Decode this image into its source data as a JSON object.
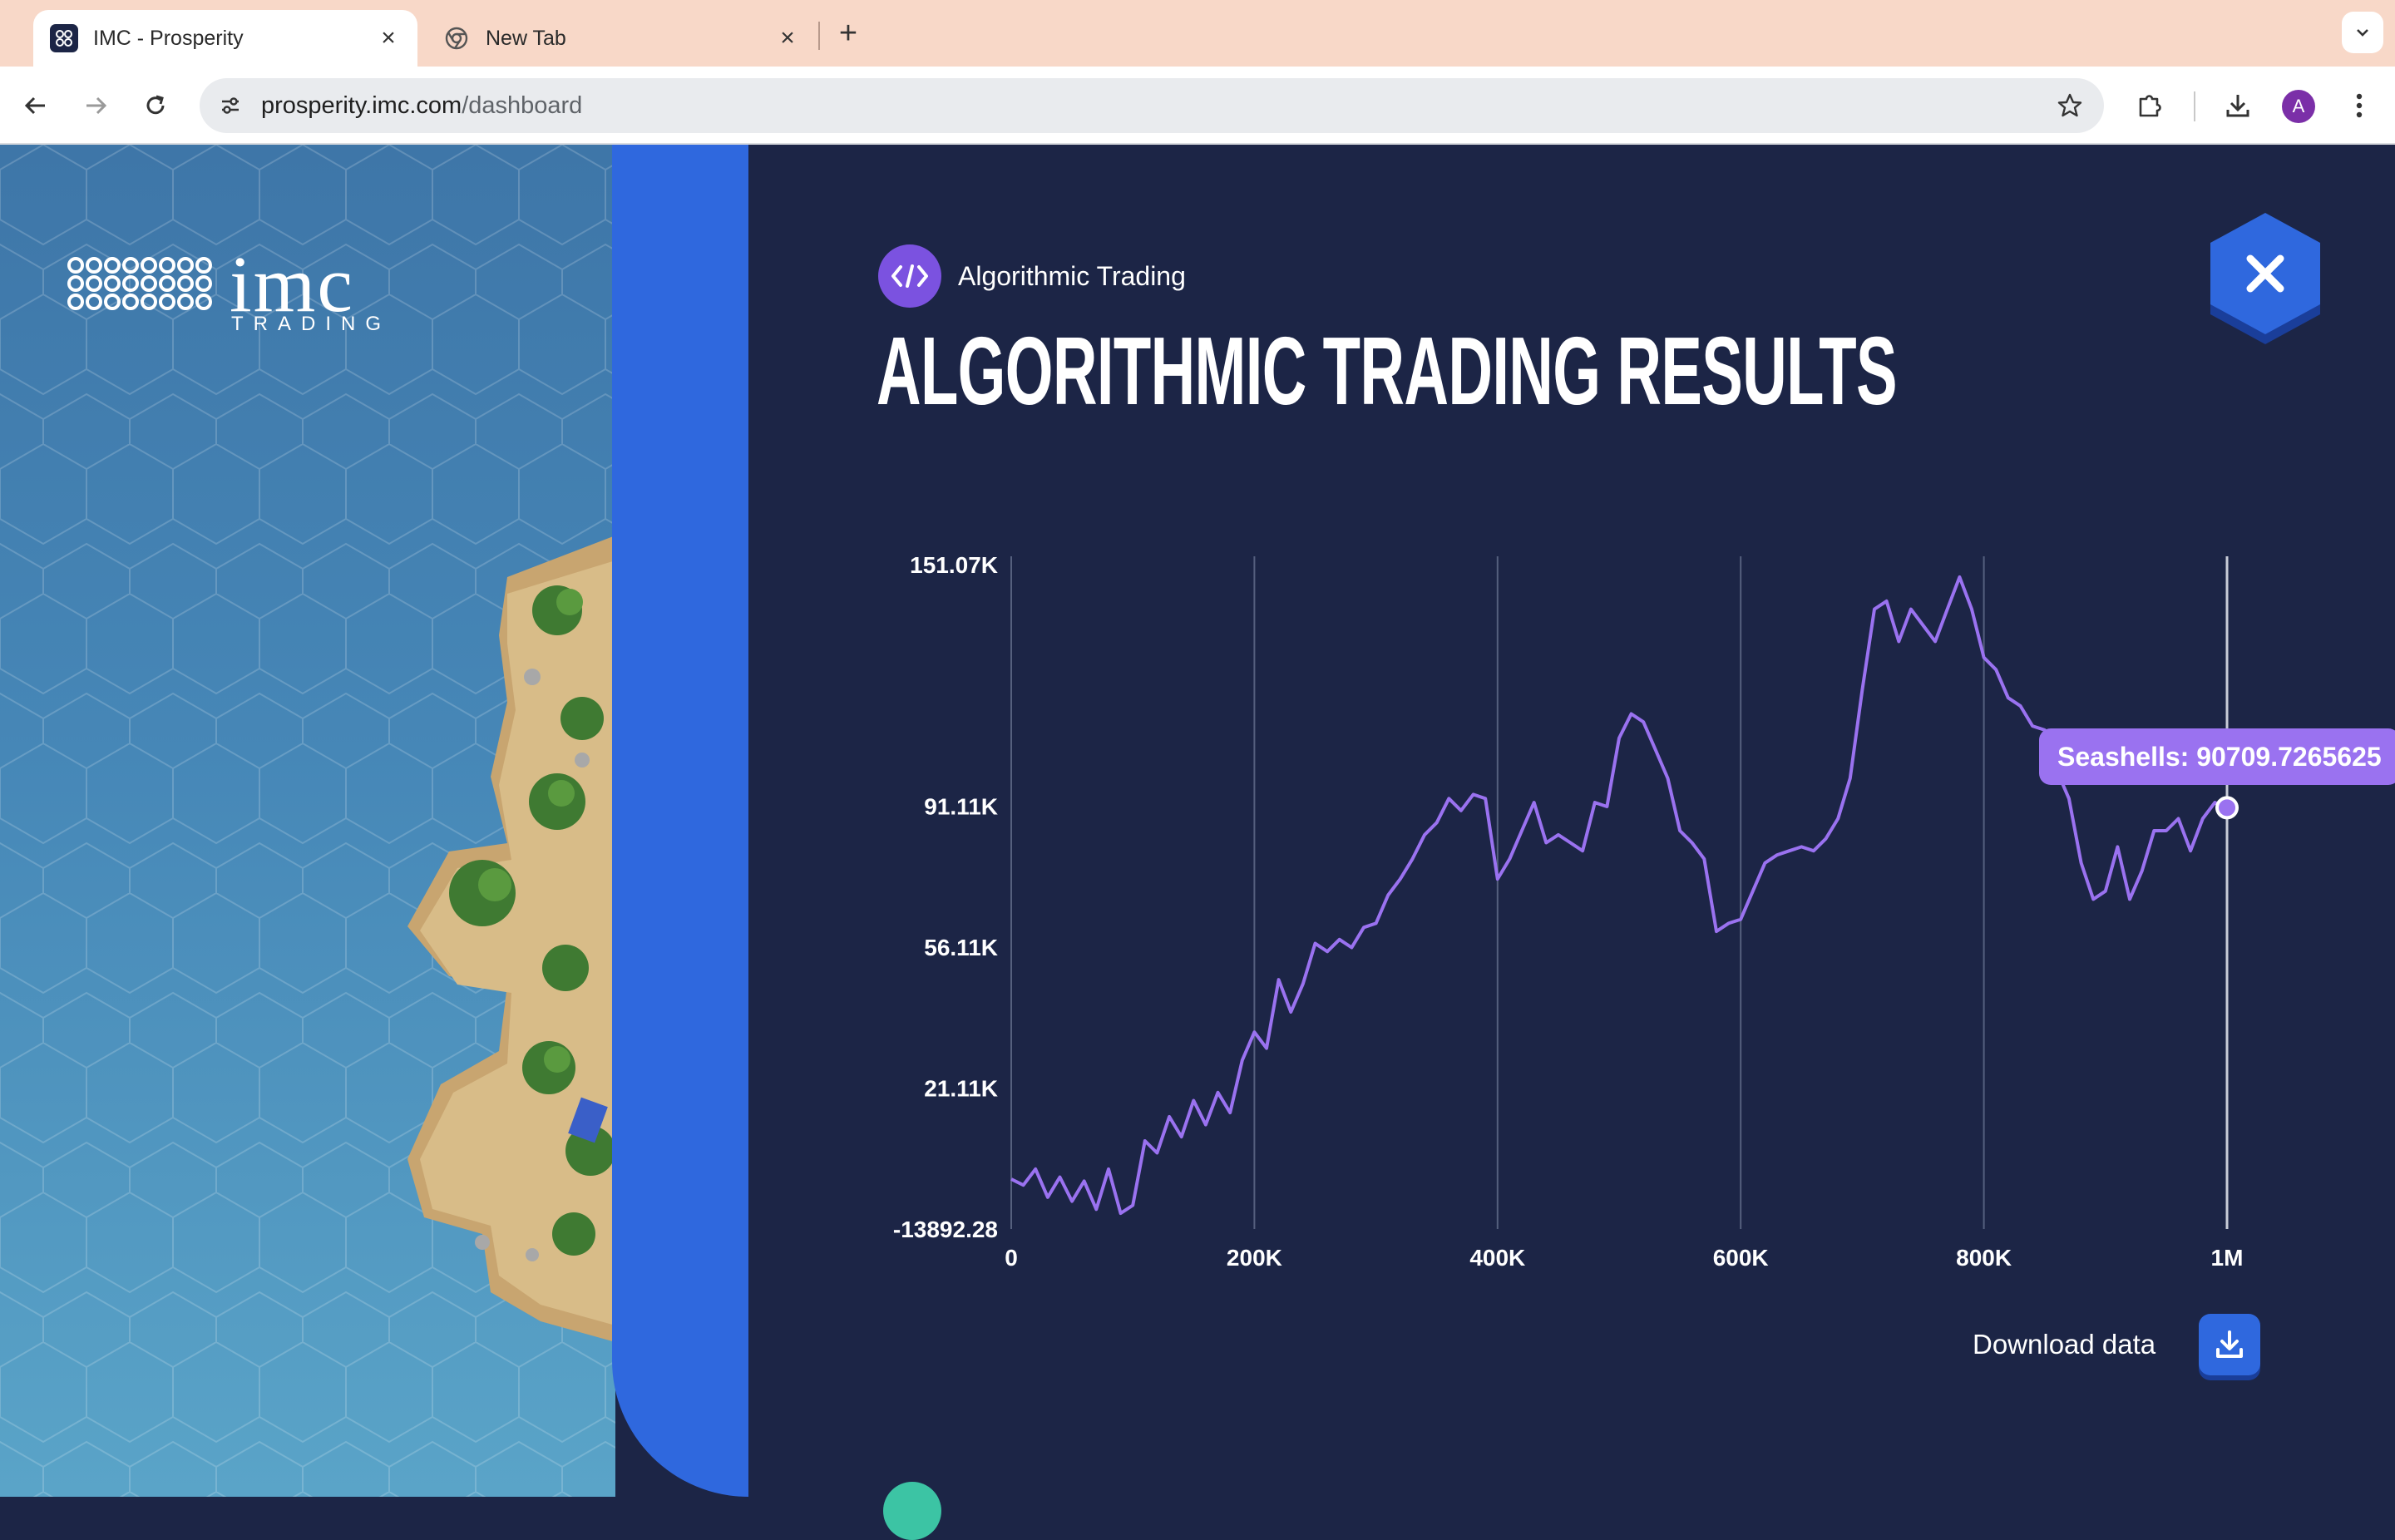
{
  "browser": {
    "tabs": [
      {
        "title": "IMC - Prosperity",
        "active": true
      },
      {
        "title": "New Tab",
        "active": false
      }
    ],
    "url_host": "prosperity.imc.com",
    "url_path": "/dashboard",
    "profile_initial": "A"
  },
  "sidebar": {
    "logo_text": "imc",
    "logo_sub": "TRADING"
  },
  "header": {
    "category_label": "Algorithmic Trading",
    "title": "ALGORITHMIC TRADING RESULTS"
  },
  "tooltip": {
    "text": "Seashells: 90709.7265625"
  },
  "actions": {
    "download_label": "Download data"
  },
  "colors": {
    "line": "#9a72f0",
    "accent": "#2f68de",
    "background": "#1c2546"
  },
  "chart_data": {
    "type": "line",
    "title": "",
    "xlabel": "",
    "ylabel": "",
    "x_ticks": [
      "0",
      "200K",
      "400K",
      "600K",
      "800K",
      "1M"
    ],
    "x_tick_values": [
      0,
      200000,
      400000,
      600000,
      800000,
      1000000
    ],
    "y_ticks": [
      "151.07K",
      "91.11K",
      "56.11K",
      "21.11K",
      "-13892.28"
    ],
    "y_tick_values": [
      151070,
      91110,
      56110,
      21110,
      -13892.28
    ],
    "xlim": [
      0,
      1000000
    ],
    "ylim": [
      -13892.28,
      151070
    ],
    "hover": {
      "x": 1000000,
      "y": 90709.7265625
    },
    "series": [
      {
        "name": "Seashells",
        "x": [
          0,
          10000,
          20000,
          30000,
          40000,
          50000,
          60000,
          70000,
          80000,
          90000,
          100000,
          110000,
          120000,
          130000,
          140000,
          150000,
          160000,
          170000,
          180000,
          190000,
          200000,
          210000,
          220000,
          230000,
          240000,
          250000,
          260000,
          270000,
          280000,
          290000,
          300000,
          310000,
          320000,
          330000,
          340000,
          350000,
          360000,
          370000,
          380000,
          390000,
          400000,
          410000,
          420000,
          430000,
          440000,
          450000,
          460000,
          470000,
          480000,
          490000,
          500000,
          510000,
          520000,
          530000,
          540000,
          550000,
          560000,
          570000,
          580000,
          590000,
          600000,
          610000,
          620000,
          630000,
          640000,
          650000,
          660000,
          670000,
          680000,
          690000,
          700000,
          710000,
          720000,
          730000,
          740000,
          750000,
          760000,
          770000,
          780000,
          790000,
          800000,
          810000,
          820000,
          830000,
          840000,
          850000,
          860000,
          870000,
          880000,
          890000,
          900000,
          910000,
          920000,
          930000,
          940000,
          950000,
          960000,
          970000,
          980000,
          990000,
          1000000
        ],
        "y": [
          -1500,
          -3000,
          1000,
          -6000,
          -1000,
          -7000,
          -2000,
          -9000,
          1000,
          -10000,
          -8000,
          8000,
          5000,
          14000,
          9000,
          18000,
          12000,
          20000,
          15000,
          28000,
          35000,
          31000,
          48000,
          40000,
          47000,
          57000,
          55000,
          58000,
          56000,
          61000,
          62000,
          69000,
          73000,
          78000,
          84000,
          87000,
          93000,
          90000,
          94000,
          93000,
          73000,
          78000,
          85000,
          92000,
          82000,
          84000,
          82000,
          80000,
          92000,
          91000,
          108000,
          114000,
          112000,
          105000,
          98000,
          85000,
          82000,
          78000,
          60000,
          62000,
          63000,
          70000,
          77000,
          79000,
          80000,
          81000,
          80000,
          83000,
          88000,
          98000,
          120000,
          140000,
          142000,
          132000,
          140000,
          136000,
          132000,
          140000,
          148000,
          140000,
          128000,
          125000,
          118000,
          116000,
          111000,
          110000,
          100000,
          93000,
          77000,
          68000,
          70000,
          81000,
          68000,
          75000,
          85000,
          85000,
          88000,
          80000,
          88000,
          92000,
          90709.7265625
        ]
      }
    ]
  }
}
